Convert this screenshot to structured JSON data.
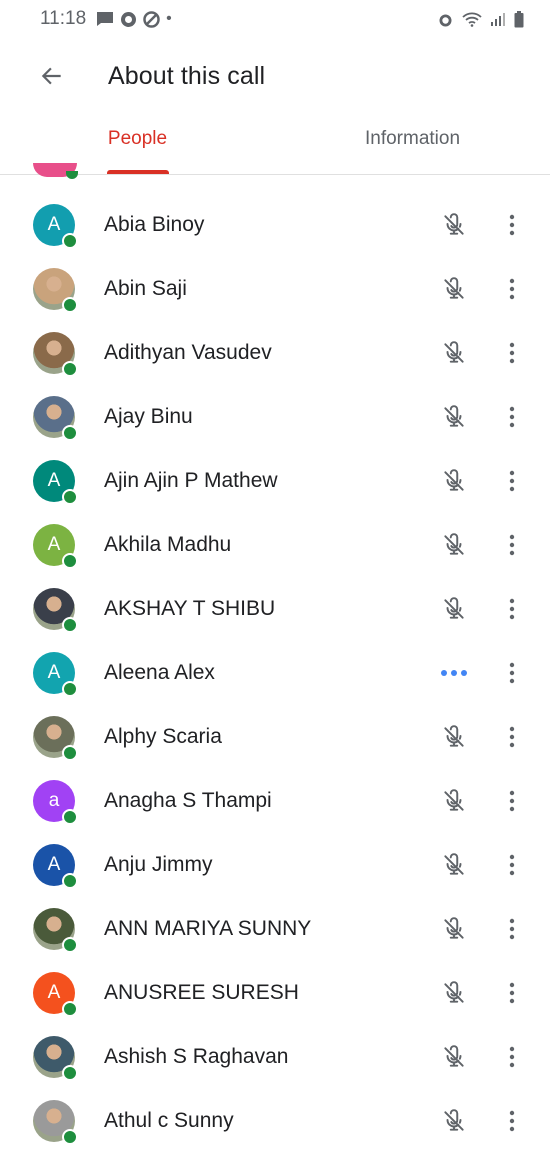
{
  "status_bar": {
    "time": "11:18",
    "dot": "•"
  },
  "app_bar": {
    "title": "About this call"
  },
  "tabs": [
    {
      "label": "People",
      "active": true
    },
    {
      "label": "Information",
      "active": false
    }
  ],
  "colors": {
    "accent": "#d93025",
    "online": "#1e8e3e",
    "talking": "#4285f4"
  },
  "participants": [
    {
      "name": "Abia Binoy",
      "initial": "A",
      "avatar": "letter",
      "color": "#129eaf",
      "status": "muted"
    },
    {
      "name": "Abin Saji",
      "initial": "",
      "avatar": "photo",
      "color": "#c9a37c",
      "status": "muted"
    },
    {
      "name": "Adithyan Vasudev",
      "initial": "",
      "avatar": "photo",
      "color": "#8a6a4a",
      "status": "muted"
    },
    {
      "name": "Ajay Binu",
      "initial": "",
      "avatar": "photo",
      "color": "#5a6f8a",
      "status": "muted"
    },
    {
      "name": "Ajin Ajin P Mathew",
      "initial": "A",
      "avatar": "letter",
      "color": "#00897b",
      "status": "muted"
    },
    {
      "name": "Akhila Madhu",
      "initial": "A",
      "avatar": "letter",
      "color": "#7cb342",
      "status": "muted"
    },
    {
      "name": "AKSHAY T SHIBU",
      "initial": "",
      "avatar": "photo",
      "color": "#3a3f4a",
      "status": "muted"
    },
    {
      "name": "Aleena Alex",
      "initial": "A",
      "avatar": "letter",
      "color": "#12a4af",
      "status": "talking"
    },
    {
      "name": "Alphy Scaria",
      "initial": "",
      "avatar": "photo",
      "color": "#6b6f5a",
      "status": "muted"
    },
    {
      "name": "Anagha S Thampi",
      "initial": "a",
      "avatar": "letter",
      "color": "#a142f4",
      "status": "muted"
    },
    {
      "name": "Anju Jimmy",
      "initial": "A",
      "avatar": "letter",
      "color": "#1a53a8",
      "status": "muted"
    },
    {
      "name": "ANN MARIYA SUNNY",
      "initial": "",
      "avatar": "photo",
      "color": "#4a5a3a",
      "status": "muted"
    },
    {
      "name": "ANUSREE SURESH",
      "initial": "A",
      "avatar": "letter",
      "color": "#f4511e",
      "status": "muted"
    },
    {
      "name": "Ashish S Raghavan",
      "initial": "",
      "avatar": "photo",
      "color": "#3e5a6a",
      "status": "muted"
    },
    {
      "name": "Athul c Sunny",
      "initial": "",
      "avatar": "photo",
      "color": "#9a9a9a",
      "status": "muted"
    }
  ]
}
